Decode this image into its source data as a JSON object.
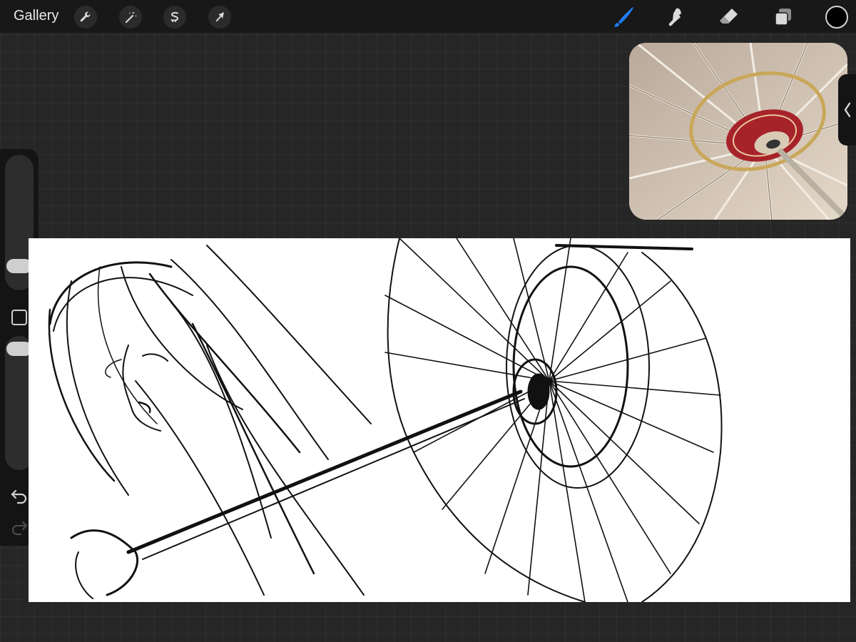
{
  "topbar": {
    "gallery_label": "Gallery",
    "left_tools": [
      {
        "name": "actions-wrench-icon"
      },
      {
        "name": "adjustments-magic-wand-icon"
      },
      {
        "name": "selection-s-icon"
      },
      {
        "name": "transform-arrow-icon"
      }
    ],
    "right_tools": [
      {
        "name": "brush-icon",
        "active": true
      },
      {
        "name": "smudge-icon",
        "active": false
      },
      {
        "name": "eraser-icon",
        "active": false
      },
      {
        "name": "layers-icon",
        "active": false
      }
    ],
    "current_color": "#000000"
  },
  "colors": {
    "background": "#262626",
    "toolbar": "#181818",
    "accent_blue": "#1f7cf2",
    "icon": "#d9d9d9"
  },
  "sidebar": {
    "brush_size_level": 0.35,
    "opacity_level": 0.95,
    "undo_icon": "undo-icon",
    "redo_icon": "redo-icon"
  },
  "reference": {
    "subject": "umbrella-underside-photo"
  }
}
